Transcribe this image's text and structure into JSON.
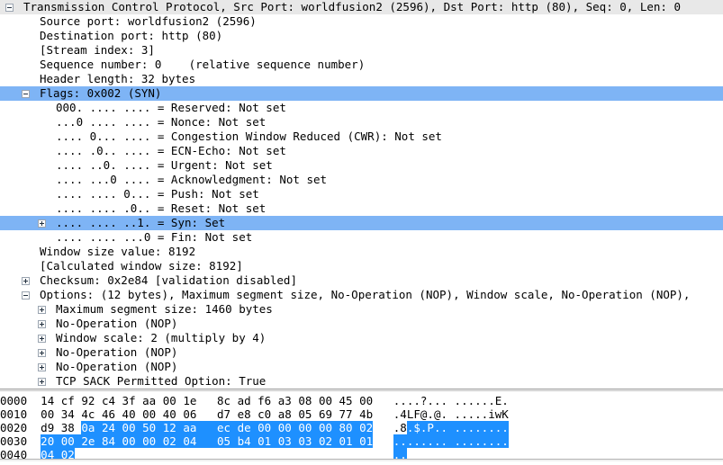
{
  "app": {
    "name": "Wireshark",
    "view": "packet-details-and-bytes"
  },
  "colors": {
    "tree_selection_blue": "#7eb4f5",
    "tree_header_gray": "#e8e8e8",
    "hex_selection_blue": "#1e90ff",
    "text": "#000000",
    "background": "#ffffff"
  },
  "detail_tree": {
    "rows": [
      {
        "indent": 0,
        "expander": "minus",
        "text": "Transmission Control Protocol, Src Port: worldfusion2 (2596), Dst Port: http (80), Seq: 0, Len: 0",
        "highlight": "gray"
      },
      {
        "indent": 1,
        "expander": "none",
        "text": "Source port: worldfusion2 (2596)",
        "highlight": "none"
      },
      {
        "indent": 1,
        "expander": "none",
        "text": "Destination port: http (80)",
        "highlight": "none"
      },
      {
        "indent": 1,
        "expander": "none",
        "text": "[Stream index: 3]",
        "highlight": "none"
      },
      {
        "indent": 1,
        "expander": "none",
        "text": "Sequence number: 0    (relative sequence number)",
        "highlight": "none"
      },
      {
        "indent": 1,
        "expander": "none",
        "text": "Header length: 32 bytes",
        "highlight": "none"
      },
      {
        "indent": 1,
        "expander": "minus",
        "text": "Flags: 0x002 (SYN)",
        "highlight": "blue"
      },
      {
        "indent": 2,
        "expander": "none",
        "text": "000. .... .... = Reserved: Not set",
        "highlight": "none"
      },
      {
        "indent": 2,
        "expander": "none",
        "text": "...0 .... .... = Nonce: Not set",
        "highlight": "none"
      },
      {
        "indent": 2,
        "expander": "none",
        "text": ".... 0... .... = Congestion Window Reduced (CWR): Not set",
        "highlight": "none"
      },
      {
        "indent": 2,
        "expander": "none",
        "text": ".... .0.. .... = ECN-Echo: Not set",
        "highlight": "none"
      },
      {
        "indent": 2,
        "expander": "none",
        "text": ".... ..0. .... = Urgent: Not set",
        "highlight": "none"
      },
      {
        "indent": 2,
        "expander": "none",
        "text": ".... ...0 .... = Acknowledgment: Not set",
        "highlight": "none"
      },
      {
        "indent": 2,
        "expander": "none",
        "text": ".... .... 0... = Push: Not set",
        "highlight": "none"
      },
      {
        "indent": 2,
        "expander": "none",
        "text": ".... .... .0.. = Reset: Not set",
        "highlight": "none"
      },
      {
        "indent": 2,
        "expander": "plus",
        "text": ".... .... ..1. = Syn: Set",
        "highlight": "blue"
      },
      {
        "indent": 2,
        "expander": "none",
        "text": ".... .... ...0 = Fin: Not set",
        "highlight": "none"
      },
      {
        "indent": 1,
        "expander": "none",
        "text": "Window size value: 8192",
        "highlight": "none"
      },
      {
        "indent": 1,
        "expander": "none",
        "text": "[Calculated window size: 8192]",
        "highlight": "none"
      },
      {
        "indent": 1,
        "expander": "plus",
        "text": "Checksum: 0x2e84 [validation disabled]",
        "highlight": "none"
      },
      {
        "indent": 1,
        "expander": "minus",
        "text": "Options: (12 bytes), Maximum segment size, No-Operation (NOP), Window scale, No-Operation (NOP),",
        "highlight": "none"
      },
      {
        "indent": 2,
        "expander": "plus",
        "text": "Maximum segment size: 1460 bytes",
        "highlight": "none"
      },
      {
        "indent": 2,
        "expander": "plus",
        "text": "No-Operation (NOP)",
        "highlight": "none"
      },
      {
        "indent": 2,
        "expander": "plus",
        "text": "Window scale: 2 (multiply by 4)",
        "highlight": "none"
      },
      {
        "indent": 2,
        "expander": "plus",
        "text": "No-Operation (NOP)",
        "highlight": "none"
      },
      {
        "indent": 2,
        "expander": "plus",
        "text": "No-Operation (NOP)",
        "highlight": "none"
      },
      {
        "indent": 2,
        "expander": "plus",
        "text": "TCP SACK Permitted Option: True",
        "highlight": "none"
      }
    ]
  },
  "hex_dump": {
    "rows": [
      {
        "offset": "0000",
        "bytes": [
          "14",
          "cf",
          "92",
          "c4",
          "3f",
          "aa",
          "00",
          "1e",
          "8c",
          "ad",
          "f6",
          "a3",
          "08",
          "00",
          "45",
          "00"
        ],
        "ascii": [
          ".",
          " ",
          ".",
          " ",
          ".",
          ".",
          "?",
          ".",
          ".",
          ".",
          ".",
          ".",
          ".",
          ".",
          "E",
          "."
        ],
        "ascii_text": "....?... ......E.",
        "highlight_start": -1,
        "highlight_end": -1
      },
      {
        "offset": "0010",
        "bytes": [
          "00",
          "34",
          "4c",
          "46",
          "40",
          "00",
          "40",
          "06",
          "d7",
          "e8",
          "c0",
          "a8",
          "05",
          "69",
          "77",
          "4b"
        ],
        "ascii_text": ".4LF@.@. .....iwK",
        "highlight_start": -1,
        "highlight_end": -1
      },
      {
        "offset": "0020",
        "bytes": [
          "d9",
          "38",
          "0a",
          "24",
          "00",
          "50",
          "12",
          "aa",
          "ec",
          "de",
          "00",
          "00",
          "00",
          "00",
          "80",
          "02"
        ],
        "ascii_text": ".8.$.P.. ........",
        "highlight_start": 2,
        "highlight_end": 15
      },
      {
        "offset": "0030",
        "bytes": [
          "20",
          "00",
          "2e",
          "84",
          "00",
          "00",
          "02",
          "04",
          "05",
          "b4",
          "01",
          "03",
          "03",
          "02",
          "01",
          "01"
        ],
        "ascii_text": "........ ........",
        "highlight_start": 0,
        "highlight_end": 15
      },
      {
        "offset": "0040",
        "bytes": [
          "04",
          "02"
        ],
        "ascii_text": "..",
        "highlight_start": 0,
        "highlight_end": 1
      }
    ]
  }
}
